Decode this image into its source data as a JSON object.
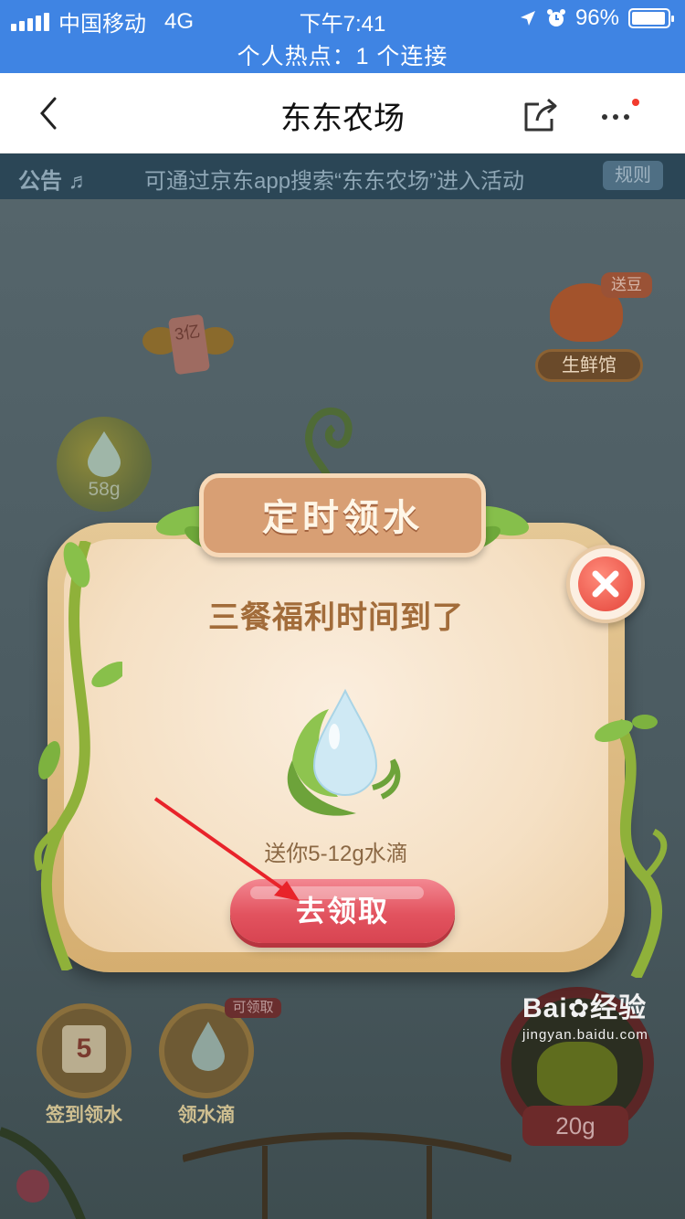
{
  "status_bar": {
    "carrier": "中国移动",
    "network": "4G",
    "time": "下午7:41",
    "battery_percent": "96%",
    "battery_level": 0.96,
    "hotspot": "个人热点：1 个连接",
    "icons": [
      "signal-icon",
      "location-arrow-icon",
      "alarm-icon",
      "battery-icon"
    ]
  },
  "navbar": {
    "title": "东东农场",
    "back_icon": "chevron-left-icon",
    "share_icon": "share-icon",
    "more_icon": "more-dots-icon"
  },
  "game": {
    "notice": {
      "label": "公告",
      "text": "可通过京东app搜索“东东农场”进入活动",
      "rules_button": "规则"
    },
    "fresh_store": {
      "label": "生鲜馆",
      "tag": "送豆"
    },
    "card_badge": {
      "text": "3亿"
    },
    "water_bubble": {
      "amount": "58g"
    },
    "bottom_left": [
      {
        "label": "签到领水",
        "day": "5"
      },
      {
        "label": "领水滴",
        "tag": "可领取"
      }
    ],
    "kettle": {
      "amount": "20g"
    }
  },
  "modal": {
    "banner_title": "定时领水",
    "heading": "三餐福利时间到了",
    "subtitle": "送你5-12g水滴",
    "claim_button": "去领取",
    "close_icon": "close-icon"
  },
  "watermark": {
    "line1": "Bai",
    "line1b": "经验",
    "line2": "jingyan.baidu.com"
  },
  "colors": {
    "status_bar": "#3f84e3",
    "claim_button": "#e2535f",
    "modal_text": "#a26c3a",
    "banner": "#d89f74"
  }
}
